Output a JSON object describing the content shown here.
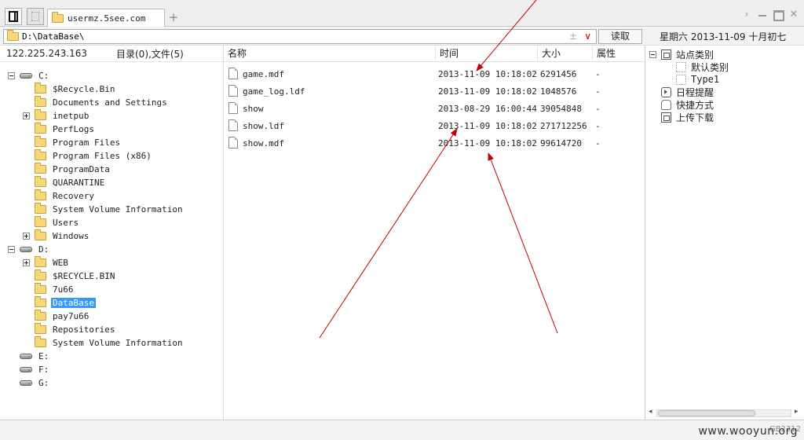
{
  "tab": {
    "title": "usermz.5see.com",
    "add": "+"
  },
  "address": {
    "value": "D:\\DataBase\\",
    "star": "±",
    "dropdown": "∨"
  },
  "read_button": "读取",
  "date_label": "星期六 2013-11-09 十月初七",
  "left_panel": {
    "ip": "122.225.243.163",
    "counts": "目录(0),文件(5)",
    "tree": [
      {
        "label": "C:",
        "kind": "drive",
        "level": 0,
        "expander": "minus"
      },
      {
        "label": "$Recycle.Bin",
        "kind": "folder",
        "level": 1
      },
      {
        "label": "Documents and Settings",
        "kind": "folder",
        "level": 1
      },
      {
        "label": "inetpub",
        "kind": "folder",
        "level": 1,
        "expander": "plus"
      },
      {
        "label": "PerfLogs",
        "kind": "folder",
        "level": 1
      },
      {
        "label": "Program Files",
        "kind": "folder",
        "level": 1
      },
      {
        "label": "Program Files (x86)",
        "kind": "folder",
        "level": 1
      },
      {
        "label": "ProgramData",
        "kind": "folder",
        "level": 1
      },
      {
        "label": "QUARANTINE",
        "kind": "folder",
        "level": 1
      },
      {
        "label": "Recovery",
        "kind": "folder",
        "level": 1
      },
      {
        "label": "System Volume Information",
        "kind": "folder",
        "level": 1
      },
      {
        "label": "Users",
        "kind": "folder",
        "level": 1
      },
      {
        "label": "Windows",
        "kind": "folder",
        "level": 1,
        "expander": "plus"
      },
      {
        "label": "D:",
        "kind": "drive",
        "level": 0,
        "expander": "minus"
      },
      {
        "label": "WEB",
        "kind": "folder",
        "level": 1,
        "expander": "plus"
      },
      {
        "label": "$RECYCLE.BIN",
        "kind": "folder",
        "level": 1
      },
      {
        "label": "7u66",
        "kind": "folder",
        "level": 1
      },
      {
        "label": "DataBase",
        "kind": "folder",
        "level": 1,
        "selected": true
      },
      {
        "label": "pay7u66",
        "kind": "folder",
        "level": 1
      },
      {
        "label": "Repositories",
        "kind": "folder",
        "level": 1
      },
      {
        "label": "System Volume Information",
        "kind": "folder",
        "level": 1
      },
      {
        "label": "E:",
        "kind": "drive",
        "level": 0
      },
      {
        "label": "F:",
        "kind": "drive",
        "level": 0
      },
      {
        "label": "G:",
        "kind": "drive",
        "level": 0
      }
    ]
  },
  "file_list": {
    "columns": {
      "name": "名称",
      "time": "时间",
      "size": "大小",
      "attr": "属性"
    },
    "rows": [
      {
        "name": "game.mdf",
        "time": "2013-11-09 10:18:02",
        "size": "6291456",
        "attr": "-"
      },
      {
        "name": "game_log.ldf",
        "time": "2013-11-09 10:18:02",
        "size": "1048576",
        "attr": "-"
      },
      {
        "name": "show",
        "time": "2013-08-29 16:00:44",
        "size": "39054848",
        "attr": "-"
      },
      {
        "name": "show.ldf",
        "time": "2013-11-09 10:18:02",
        "size": "271712256",
        "attr": "-"
      },
      {
        "name": "show.mdf",
        "time": "2013-11-09 10:18:02",
        "size": "99614720",
        "attr": "-"
      }
    ]
  },
  "right_panel": {
    "items": [
      {
        "label": "站点类别",
        "icon": "site-icon",
        "expander": "minus",
        "level": 0
      },
      {
        "label": "默认类别",
        "icon": "category-icon",
        "level": 1
      },
      {
        "label": "Type1",
        "icon": "category-icon",
        "level": 1
      },
      {
        "label": "日程提醒",
        "icon": "schedule-icon",
        "level": 0
      },
      {
        "label": "快捷方式",
        "icon": "shortcut-icon",
        "level": 0
      },
      {
        "label": "上传下载",
        "icon": "transfer-icon",
        "level": 0
      }
    ]
  },
  "status": {
    "encoding": "GB2312"
  },
  "watermark": "www.wooyun.org",
  "annotation_color": "#c00000"
}
